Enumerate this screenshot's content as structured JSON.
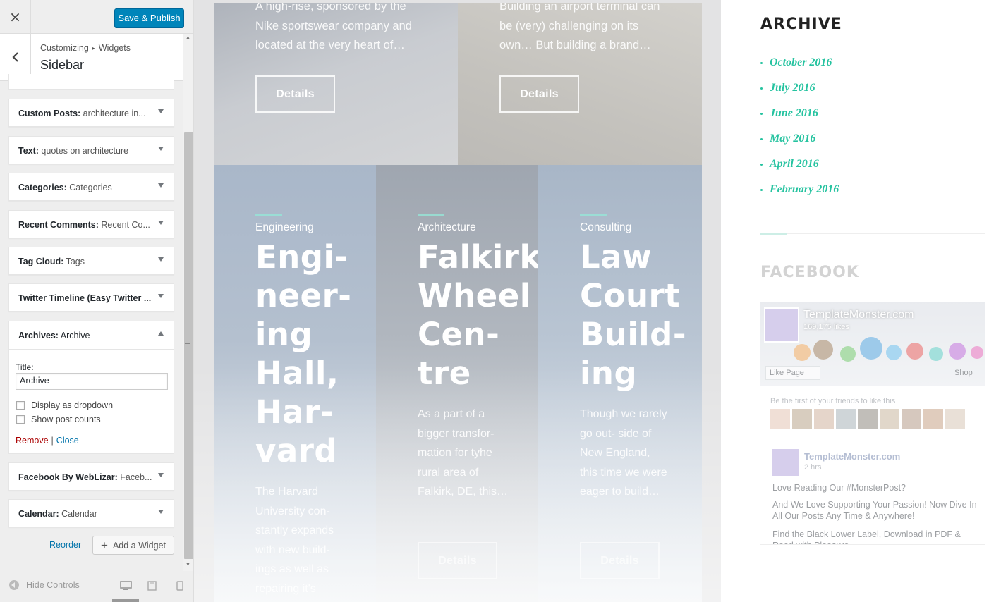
{
  "customizer": {
    "close_glyph": "×",
    "publish_label": "Save & Publish",
    "breadcrumb_root": "Customizing",
    "breadcrumb_sep": "▸",
    "breadcrumb_leaf": "Widgets",
    "section_title": "Sidebar",
    "widgets": [
      {
        "name": "Custom Posts:",
        "title": " architecture in..."
      },
      {
        "name": "Text:",
        "title": " quotes on architecture"
      },
      {
        "name": "Categories:",
        "title": " Categories"
      },
      {
        "name": "Recent Comments:",
        "title": " Recent Co..."
      },
      {
        "name": "Tag Cloud:",
        "title": " Tags"
      },
      {
        "name": "Twitter Timeline (Easy Twitter ...",
        "title": ""
      }
    ],
    "archives_widget": {
      "name": "Archives:",
      "title": " Archive",
      "field_label": "Title:",
      "field_value": "Archive",
      "dropdown_label": "Display as dropdown",
      "dropdown_checked": false,
      "counts_label": "Show post counts",
      "counts_checked": false,
      "remove_label": "Remove",
      "pipe": "|",
      "close_label": "Close"
    },
    "widgets_after": [
      {
        "name": "Facebook By WebLizar:",
        "title": " Faceb..."
      },
      {
        "name": "Calendar:",
        "title": " Calendar"
      }
    ],
    "reorder_label": "Reorder",
    "add_widget_label": "Add a Widget",
    "hide_controls_label": "Hide Controls",
    "devices": [
      "desktop-icon",
      "tablet-icon",
      "mobile-icon"
    ],
    "accent_color": "#0085ba"
  },
  "preview": {
    "top_cards": [
      {
        "excerpt": "A high-rise, sponsored by the Nike sportswear company and located at the very heart of…",
        "button": "Details"
      },
      {
        "excerpt": "Building an airport terminal can be (very) challenging on its own… But building a brand…",
        "button": "Details"
      }
    ],
    "project_cards": [
      {
        "category": "Engineering",
        "title_lines": [
          "Engi-",
          "neer-",
          "ing",
          "Hall,",
          "Har-",
          "vard"
        ],
        "excerpt": "The Harvard University con- stantly expands with new build- ings as well as repairing it's",
        "button": ""
      },
      {
        "category": "Architecture",
        "title_lines": [
          "Falkirk",
          "Wheel",
          "Cen-",
          "tre"
        ],
        "excerpt": "As a part of a bigger transfor- mation for tyhe rural area of Falkirk, DE, this…",
        "button": "Details"
      },
      {
        "category": "Consulting",
        "title_lines": [
          "Law",
          "Court",
          "Build-",
          "ing"
        ],
        "excerpt": "Though we rarely go out- side of New England, this time we were eager to build…",
        "button": "Details"
      }
    ],
    "sidebar": {
      "archive_heading": "ARCHIVE",
      "archive_items": [
        "October 2016",
        "July 2016",
        "June 2016",
        "May 2016",
        "April 2016",
        "February 2016"
      ],
      "facebook_heading": "FACEBOOK",
      "accent_color": "#26c3a0",
      "fb": {
        "page_name": "TemplateMonster.com",
        "likes": "169,175 likes",
        "like_btn": "Like Page",
        "shop": "Shop",
        "friends_note": "Be the first of your friends to like this",
        "post_name": "TemplateMonster.com",
        "post_time": "2 hrs",
        "post_line1": "Love Reading Our #MonsterPost?",
        "post_line2": "And We Love Supporting Your Passion! Now Dive In All Our Posts Any Time & Anywhere!",
        "post_line3": "Find the Black Lower Label, Download in PDF & Read with Pleasure -"
      }
    }
  }
}
